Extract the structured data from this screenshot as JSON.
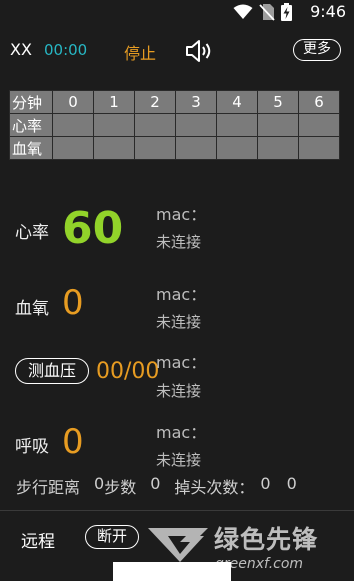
{
  "status_bar": {
    "time": "9:46",
    "icons": [
      "wifi-icon",
      "no-sim-icon",
      "battery-charging-icon"
    ]
  },
  "header": {
    "user": "XX",
    "timer": "00:00",
    "stop_label": "停止",
    "sound_icon": "speaker-icon",
    "more_label": "更多"
  },
  "grid": {
    "header_label": "分钟",
    "minutes": [
      "0",
      "1",
      "2",
      "3",
      "4",
      "5",
      "6"
    ],
    "rows": [
      {
        "label": "心率"
      },
      {
        "label": "血氧"
      }
    ]
  },
  "heart_rate": {
    "label": "心率",
    "value": "60",
    "mac_label": "mac：",
    "status": "未连接"
  },
  "spo2": {
    "label": "血氧",
    "value": "0",
    "mac_label": "mac：",
    "status": "未连接"
  },
  "blood_pressure": {
    "button_label": "测血压",
    "value": "00/00",
    "mac_label": "mac：",
    "status": "未连接"
  },
  "respiration": {
    "label": "呼吸",
    "value": "0",
    "mac_label": "mac：",
    "status": "未连接"
  },
  "stats": {
    "distance_label": "步行距离",
    "distance_value": "0",
    "steps_label": "步数",
    "steps_value": "0",
    "head_drop_label": "掉头次数：",
    "head_drop_value_1": "0",
    "head_drop_value_2": "0"
  },
  "remote": {
    "label": "远程",
    "disconnect_label": "断开"
  },
  "watermark": {
    "text": "绿色先锋",
    "url": "greenxf.com"
  },
  "colors": {
    "background": "#1c1c1c",
    "heart_rate": "#92d32a",
    "accent_orange": "#e79c22",
    "timer_cyan": "#27b7c4",
    "grid_cell": "#7b7b7b"
  }
}
